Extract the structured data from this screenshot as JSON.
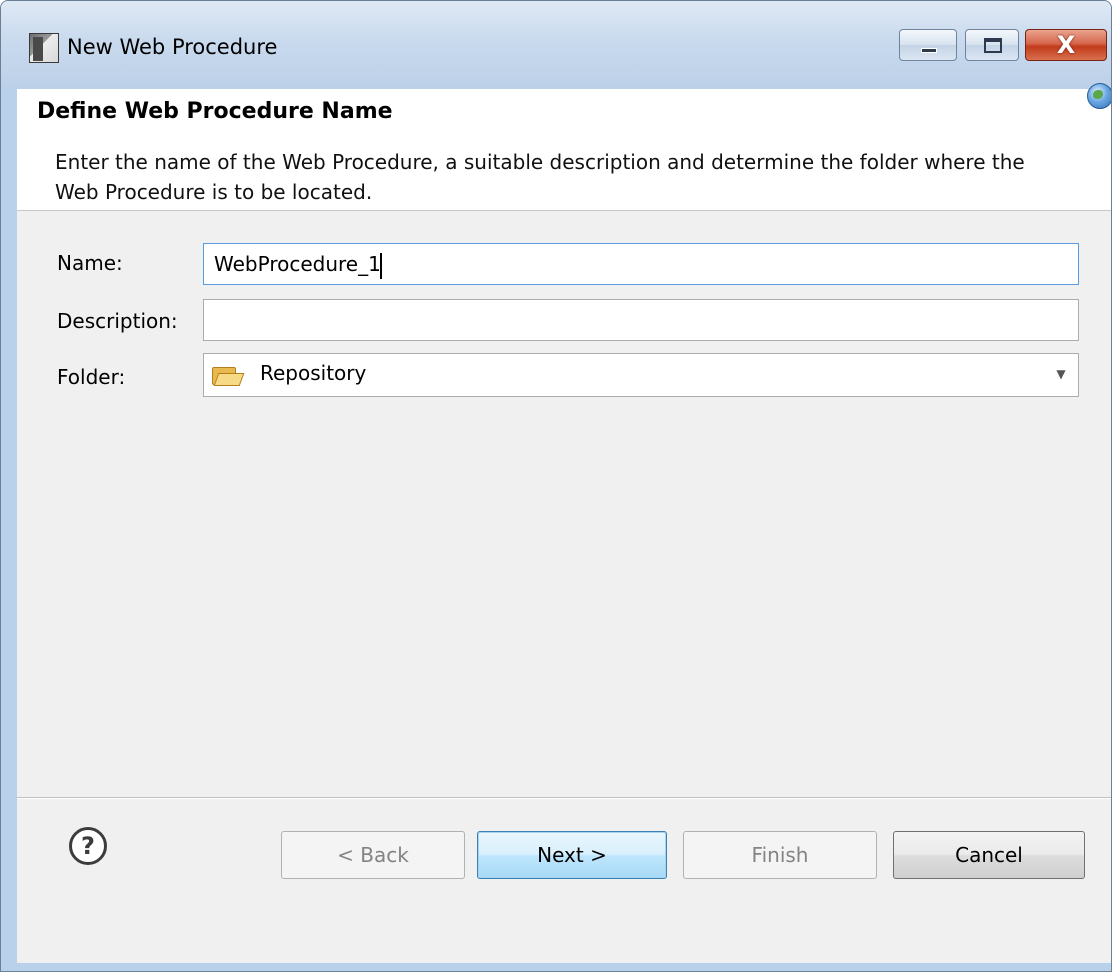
{
  "window": {
    "title": "New Web Procedure",
    "icon": "wizard-icon",
    "controls": {
      "minimize": "minimize-icon",
      "maximize": "maximize-icon",
      "close_glyph": "X"
    }
  },
  "header": {
    "title": "Define Web Procedure Name",
    "description": "Enter the name of the Web Procedure, a suitable description and determine the folder where the Web Procedure is to be located.",
    "badge_icon": "globe-icon"
  },
  "form": {
    "name_label": "Name:",
    "name_value": "WebProcedure_1",
    "description_label": "Description:",
    "description_value": "",
    "folder_label": "Folder:",
    "folder_value": "Repository",
    "folder_icon": "folder-open-icon"
  },
  "footer": {
    "help_glyph": "?",
    "back_label": "< Back",
    "next_label": "Next >",
    "finish_label": "Finish",
    "cancel_label": "Cancel"
  }
}
